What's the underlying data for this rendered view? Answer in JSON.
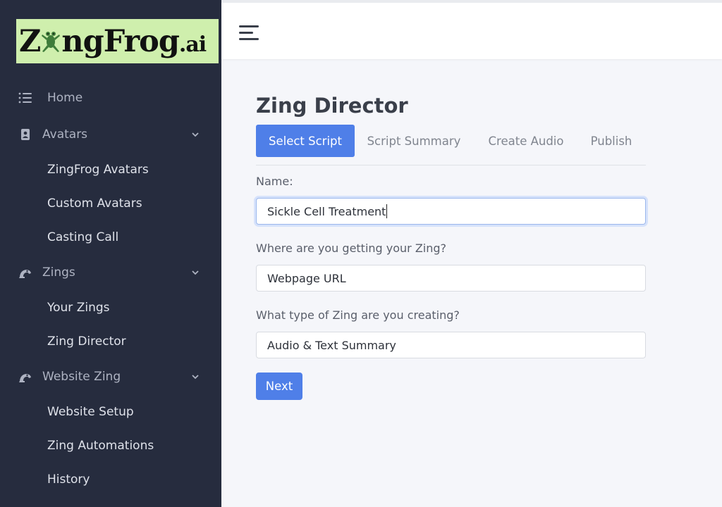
{
  "logo": {
    "main": "Z ngFrog",
    "prefix": "Z",
    "suffix": "ngFrog",
    "tld": ".ai"
  },
  "sidebar": {
    "home": {
      "label": "Home",
      "icon": "list-icon"
    },
    "avatars": {
      "label": "Avatars",
      "icon": "contact-card-icon",
      "items": [
        "ZingFrog Avatars",
        "Custom Avatars",
        "Casting Call"
      ]
    },
    "zings": {
      "label": "Zings",
      "icon": "frog-icon",
      "items": [
        "Your Zings",
        "Zing Director"
      ]
    },
    "website_zing": {
      "label": "Website Zing",
      "icon": "frog-icon",
      "items": [
        "Website Setup",
        "Zing Automations",
        "History"
      ]
    }
  },
  "header": {
    "menu_icon": "hamburger-menu-icon"
  },
  "page": {
    "title": "Zing Director",
    "tabs": [
      "Select Script",
      "Script Summary",
      "Create Audio",
      "Publish"
    ],
    "active_tab": "Select Script",
    "name_label": "Name:",
    "name_value": "Sickle Cell Treatment",
    "source_label": "Where are you getting your Zing?",
    "source_value": "Webpage URL",
    "type_label": "What type of Zing are you creating?",
    "type_value": "Audio & Text Summary",
    "next_label": "Next"
  },
  "colors": {
    "sidebar_bg": "#262c3e",
    "accent": "#4f7fe8",
    "logo_bg": "#cfefad"
  }
}
